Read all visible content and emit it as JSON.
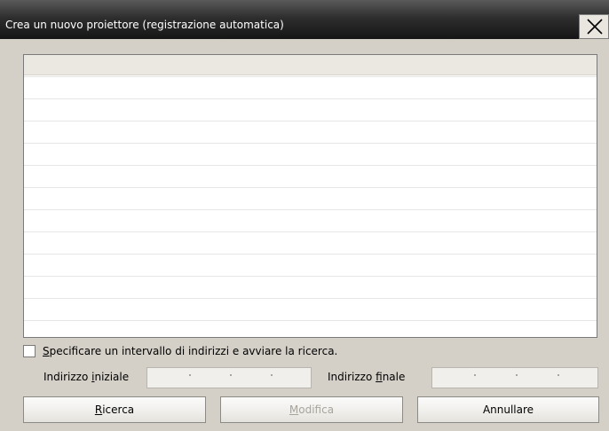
{
  "window": {
    "title": "Crea un nuovo proiettore (registrazione automatica)"
  },
  "icons": {
    "close": "close-icon"
  },
  "range": {
    "checkbox_label": "Specificare un intervallo di indirizzi e avviare la ricerca.",
    "checkbox_underline": "S",
    "checkbox_rest": "pecificare un intervallo di indirizzi e avviare la ricerca.",
    "checked": false,
    "start_label_pre": "Indirizzo ",
    "start_label_ul": "i",
    "start_label_post": "niziale",
    "end_label_pre": "Indirizzo ",
    "end_label_ul": "f",
    "end_label_post": "inale"
  },
  "buttons": {
    "search_ul": "R",
    "search_rest": "icerca",
    "modify_ul": "M",
    "modify_rest": "odifica",
    "modify_enabled": false,
    "cancel": "Annullare"
  },
  "colors": {
    "titlebar": "#2e2e2e",
    "dialog_bg": "#d4d0c8",
    "disabled_text": "#a7a49c"
  }
}
